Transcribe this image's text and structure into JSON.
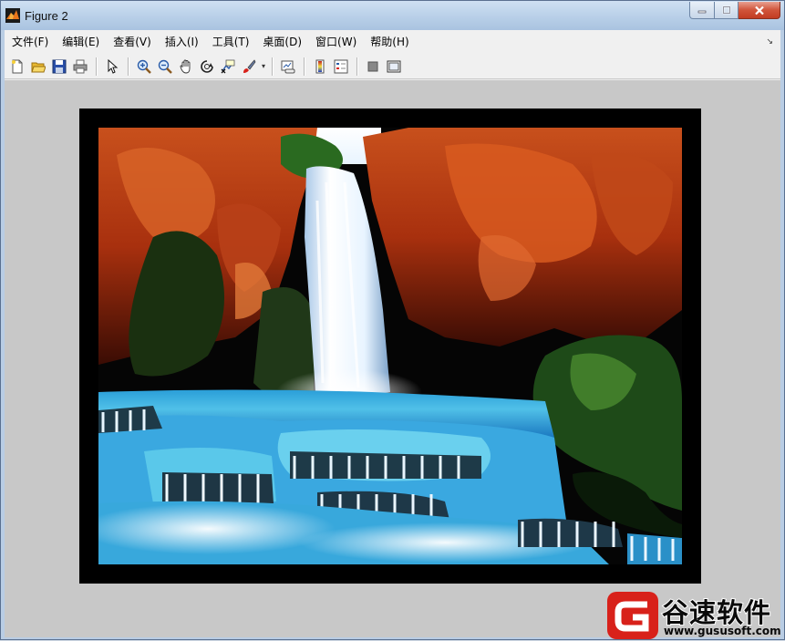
{
  "window": {
    "title": "Figure 2"
  },
  "menu": {
    "items": [
      {
        "label": "文件(F)"
      },
      {
        "label": "编辑(E)"
      },
      {
        "label": "查看(V)"
      },
      {
        "label": "插入(I)"
      },
      {
        "label": "工具(T)"
      },
      {
        "label": "桌面(D)"
      },
      {
        "label": "窗口(W)"
      },
      {
        "label": "帮助(H)"
      }
    ]
  },
  "toolbar": {
    "buttons": [
      {
        "icon": "new-file-icon"
      },
      {
        "icon": "open-folder-icon"
      },
      {
        "icon": "save-icon"
      },
      {
        "icon": "print-icon"
      },
      {
        "icon": "select-arrow-icon"
      },
      {
        "icon": "zoom-in-icon"
      },
      {
        "icon": "zoom-out-icon"
      },
      {
        "icon": "pan-hand-icon"
      },
      {
        "icon": "rotate-3d-icon"
      },
      {
        "icon": "data-cursor-icon"
      },
      {
        "icon": "brush-icon"
      },
      {
        "icon": "link-plot-icon"
      },
      {
        "icon": "colorbar-icon"
      },
      {
        "icon": "legend-icon"
      },
      {
        "icon": "hide-plot-tools-icon"
      },
      {
        "icon": "show-plot-tools-icon"
      }
    ]
  },
  "figure": {
    "image": "waterfall-photo"
  },
  "watermark": {
    "name": "谷速软件",
    "url": "www.gususoft.com"
  },
  "colors": {
    "accent": "#d8211a",
    "titlebar": "#bcd2ea",
    "figure_bg": "#c8c8c8"
  }
}
